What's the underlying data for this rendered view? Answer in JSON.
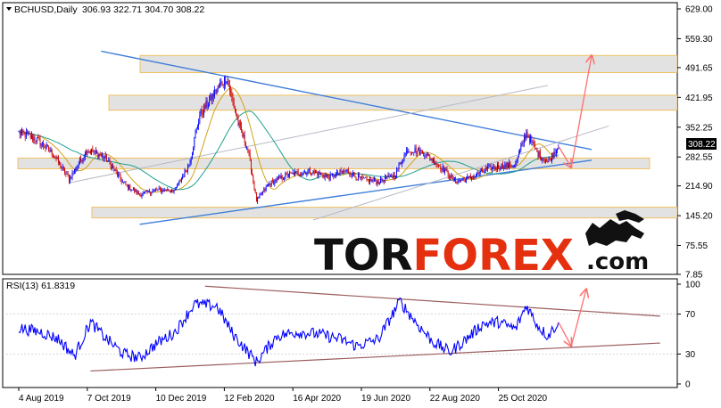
{
  "header": {
    "symbol": "BCHUSD,Daily",
    "ohlc": "306.93 322.71 304.70 308.22",
    "rsi_label": "RSI(13) 61.8319"
  },
  "price_badge": "308.22",
  "logo": {
    "part1": "TOR",
    "part2": "FOREX",
    "part3": ".com"
  },
  "colors": {
    "bull": "#0000ff",
    "bear": "#cc0000",
    "trend_blue": "#3f7fd8",
    "channel_gray": "#b8b8c8",
    "zone_fill": "#d8d8d8",
    "zone_border": "#f0c060",
    "arrow": "#ff6f6f",
    "ma_fast": "#d4a017",
    "ma_slow": "#20a090",
    "rsi_line": "#0000ff",
    "rsi_trend": "#9b5c5c",
    "logo_dark": "#111111",
    "logo_red": "#e53010"
  },
  "chart_data": [
    {
      "type": "candlestick",
      "title": "BCHUSD,Daily",
      "y_ticks": [
        "629.00",
        "559.30",
        "491.65",
        "421.95",
        "352.25",
        "282.55",
        "214.90",
        "145.20",
        "75.55",
        "7.85"
      ],
      "ylim": [
        7.85,
        629.0
      ],
      "x_ticks": [
        "4 Aug 2019",
        "7 Oct 2019",
        "10 Dec 2019",
        "12 Feb 2020",
        "16 Apr 2020",
        "19 Jun 2020",
        "22 Aug 2020",
        "25 Oct 2020"
      ],
      "last_price": 308.22,
      "close_path": [
        {
          "x": "2019-08-04",
          "y": 340
        },
        {
          "x": "2019-08-20",
          "y": 325
        },
        {
          "x": "2019-09-05",
          "y": 290
        },
        {
          "x": "2019-09-20",
          "y": 230
        },
        {
          "x": "2019-10-07",
          "y": 300
        },
        {
          "x": "2019-10-24",
          "y": 280
        },
        {
          "x": "2019-11-10",
          "y": 220
        },
        {
          "x": "2019-11-25",
          "y": 195
        },
        {
          "x": "2019-12-10",
          "y": 205
        },
        {
          "x": "2019-12-28",
          "y": 205
        },
        {
          "x": "2020-01-10",
          "y": 265
        },
        {
          "x": "2020-01-20",
          "y": 380
        },
        {
          "x": "2020-02-05",
          "y": 440
        },
        {
          "x": "2020-02-14",
          "y": 470
        },
        {
          "x": "2020-02-25",
          "y": 360
        },
        {
          "x": "2020-03-05",
          "y": 300
        },
        {
          "x": "2020-03-13",
          "y": 180
        },
        {
          "x": "2020-03-25",
          "y": 220
        },
        {
          "x": "2020-04-10",
          "y": 240
        },
        {
          "x": "2020-05-01",
          "y": 250
        },
        {
          "x": "2020-05-20",
          "y": 235
        },
        {
          "x": "2020-06-05",
          "y": 250
        },
        {
          "x": "2020-06-19",
          "y": 230
        },
        {
          "x": "2020-07-05",
          "y": 225
        },
        {
          "x": "2020-07-20",
          "y": 240
        },
        {
          "x": "2020-08-01",
          "y": 300
        },
        {
          "x": "2020-08-15",
          "y": 295
        },
        {
          "x": "2020-09-01",
          "y": 260
        },
        {
          "x": "2020-09-15",
          "y": 225
        },
        {
          "x": "2020-10-01",
          "y": 235
        },
        {
          "x": "2020-10-15",
          "y": 255
        },
        {
          "x": "2020-10-25",
          "y": 260
        },
        {
          "x": "2020-11-10",
          "y": 265
        },
        {
          "x": "2020-11-20",
          "y": 340
        },
        {
          "x": "2020-12-01",
          "y": 290
        },
        {
          "x": "2020-12-10",
          "y": 270
        },
        {
          "x": "2020-12-20",
          "y": 308.22
        }
      ],
      "zones": [
        {
          "y_low": 480,
          "y_high": 520
        },
        {
          "y_low": 392,
          "y_high": 427
        },
        {
          "y_low": 255,
          "y_high": 280
        },
        {
          "y_low": 140,
          "y_high": 165
        }
      ],
      "trendlines": [
        {
          "x1": "2019-10-20",
          "y1": 530,
          "x2": "2021-01-20",
          "y2": 300,
          "color": "trend_blue"
        },
        {
          "x1": "2019-11-25",
          "y1": 125,
          "x2": "2021-01-20",
          "y2": 275,
          "color": "trend_blue"
        },
        {
          "x1": "2019-09-20",
          "y1": 222,
          "x2": "2020-12-10",
          "y2": 450,
          "color": "channel_gray"
        },
        {
          "x1": "2020-05-05",
          "y1": 135,
          "x2": "2021-02-05",
          "y2": 355,
          "color": "channel_gray"
        }
      ],
      "forecast_arrows": [
        {
          "from_x": "2020-12-20",
          "from_y": 308,
          "to_x": "2021-01-01",
          "to_y": 258
        },
        {
          "from_x": "2021-01-01",
          "from_y": 258,
          "to_x": "2021-01-20",
          "to_y": 520
        }
      ]
    },
    {
      "type": "line",
      "title": "RSI(13) 61.8319",
      "y_ticks": [
        "100",
        "70",
        "30",
        "0"
      ],
      "ylim": [
        0,
        100
      ],
      "last_value": 61.8319,
      "path": [
        {
          "x": "2019-08-04",
          "y": 56
        },
        {
          "x": "2019-08-25",
          "y": 52
        },
        {
          "x": "2019-09-10",
          "y": 45
        },
        {
          "x": "2019-09-25",
          "y": 28
        },
        {
          "x": "2019-10-10",
          "y": 62
        },
        {
          "x": "2019-10-25",
          "y": 45
        },
        {
          "x": "2019-11-10",
          "y": 30
        },
        {
          "x": "2019-11-25",
          "y": 26
        },
        {
          "x": "2019-12-10",
          "y": 40
        },
        {
          "x": "2019-12-28",
          "y": 52
        },
        {
          "x": "2020-01-15",
          "y": 80
        },
        {
          "x": "2020-02-05",
          "y": 78
        },
        {
          "x": "2020-02-20",
          "y": 50
        },
        {
          "x": "2020-03-13",
          "y": 22
        },
        {
          "x": "2020-04-01",
          "y": 48
        },
        {
          "x": "2020-04-20",
          "y": 52
        },
        {
          "x": "2020-05-10",
          "y": 50
        },
        {
          "x": "2020-05-30",
          "y": 45
        },
        {
          "x": "2020-06-15",
          "y": 38
        },
        {
          "x": "2020-07-05",
          "y": 45
        },
        {
          "x": "2020-07-25",
          "y": 83
        },
        {
          "x": "2020-08-10",
          "y": 60
        },
        {
          "x": "2020-08-25",
          "y": 42
        },
        {
          "x": "2020-09-10",
          "y": 32
        },
        {
          "x": "2020-09-25",
          "y": 45
        },
        {
          "x": "2020-10-10",
          "y": 60
        },
        {
          "x": "2020-10-25",
          "y": 62
        },
        {
          "x": "2020-11-10",
          "y": 55
        },
        {
          "x": "2020-11-20",
          "y": 79
        },
        {
          "x": "2020-12-01",
          "y": 58
        },
        {
          "x": "2020-12-10",
          "y": 48
        },
        {
          "x": "2020-12-20",
          "y": 61.8
        }
      ],
      "trendlines": [
        {
          "x1": "2020-01-25",
          "y1": 98,
          "x2": "2021-03-25",
          "y2": 68
        },
        {
          "x1": "2019-10-10",
          "y1": 13,
          "x2": "2021-03-25",
          "y2": 41
        }
      ],
      "forecast_arrows": [
        {
          "from_x": "2020-12-20",
          "from_y": 62,
          "to_x": "2021-01-01",
          "to_y": 38
        },
        {
          "from_x": "2021-01-01",
          "from_y": 38,
          "to_x": "2021-01-15",
          "to_y": 95
        }
      ]
    }
  ]
}
